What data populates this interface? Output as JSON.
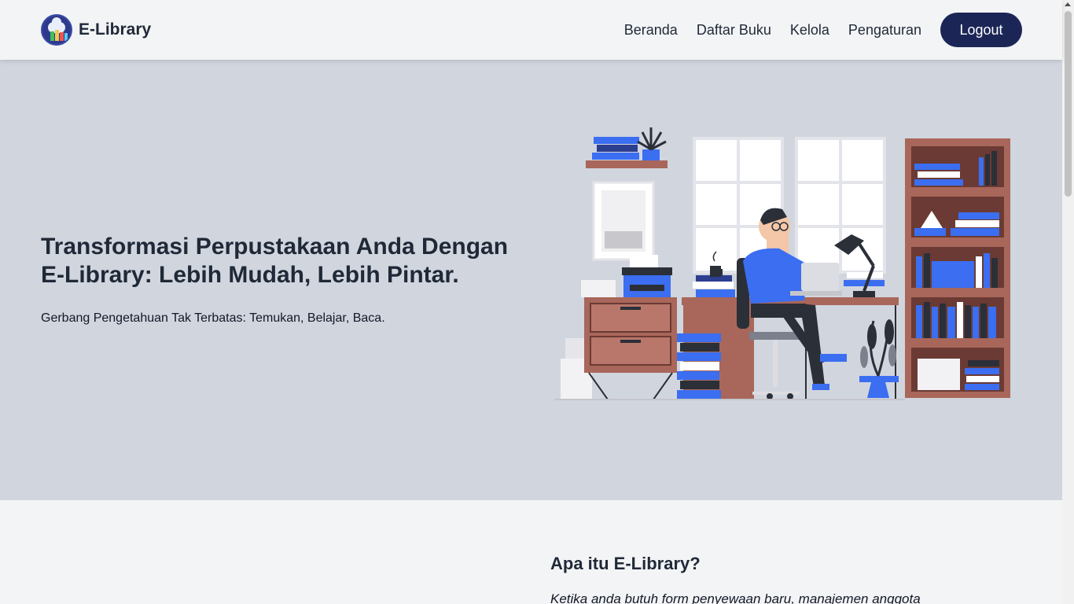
{
  "navbar": {
    "brand_name": "E-Library",
    "links": [
      "Beranda",
      "Daftar Buku",
      "Kelola",
      "Pengaturan"
    ],
    "logout_label": "Logout"
  },
  "hero": {
    "title_line1": "Transformasi Perpustakaan Anda Dengan",
    "title_line2": "E-Library: Lebih Mudah, Lebih Pintar.",
    "subtitle": "Gerbang Pengetahuan Tak Terbatas: Temukan, Belajar, Baca."
  },
  "about": {
    "title": "Apa itu E-Library?",
    "text": "Ketika anda butuh form penyewaan baru, manajemen anggota"
  },
  "colors": {
    "hero_bg": "#d1d5de",
    "accent_blue": "#3b6ef0",
    "button_navy": "#1b2657",
    "wood": "#a8675a"
  }
}
